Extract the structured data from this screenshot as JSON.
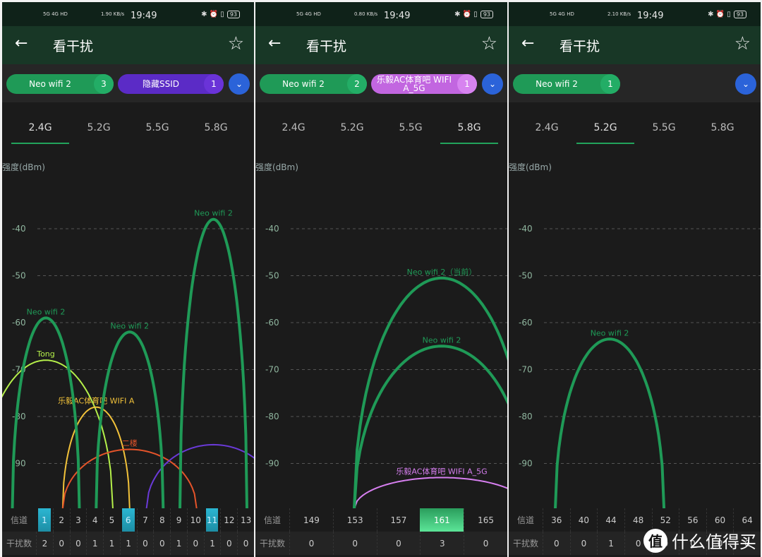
{
  "app_title": "看干扰",
  "y_unit": "强度(dBm)",
  "y_ticks": [
    -40,
    -50,
    -60,
    -70,
    -80,
    -90
  ],
  "row_labels": {
    "channel": "信道",
    "interference": "干扰数"
  },
  "tabs": [
    "2.4G",
    "5.2G",
    "5.5G",
    "5.8G"
  ],
  "watermark": {
    "circle": "值",
    "text": "什么值得买"
  },
  "panels": [
    {
      "status": {
        "time": "19:49",
        "speed": "1.90 KB/s",
        "battery": "93",
        "left": "5G 4G HD"
      },
      "chips": [
        {
          "label": "Neo wifi 2",
          "count": "3",
          "color": "#1f9a57",
          "count_color": "#23ad66"
        },
        {
          "label": "隐藏SSID",
          "count": "1",
          "color": "#5b2bc6",
          "count_color": "#6a33d8"
        }
      ],
      "selected_tab": "2.4G",
      "channels": [
        "1",
        "2",
        "3",
        "4",
        "5",
        "6",
        "7",
        "8",
        "9",
        "10",
        "11",
        "12",
        "13"
      ],
      "interference": [
        "2",
        "0",
        "0",
        "1",
        "1",
        "1",
        "0",
        "0",
        "1",
        "0",
        "1",
        "0",
        "0"
      ],
      "highlighted": [
        "1",
        "6",
        "11"
      ],
      "highlight_style": "cyan",
      "networks": [
        {
          "name": "Tong",
          "channel": 1,
          "dbm": -68,
          "halfwidth": 4,
          "color": "#b5f04a",
          "thick": false
        },
        {
          "name": "乐毅AC体育吧 WIFI A",
          "channel": 4,
          "dbm": -78,
          "halfwidth": 2,
          "color": "#f2c23a",
          "thick": false
        },
        {
          "name": "二楼",
          "channel": 6,
          "dbm": -87,
          "halfwidth": 4,
          "color": "#e5542a",
          "thick": false
        },
        {
          "name": "",
          "channel": 11,
          "dbm": -86,
          "halfwidth": 4,
          "color": "#6a3ad8",
          "thick": false
        },
        {
          "name": "Neo wifi 2",
          "channel": 1,
          "dbm": -59,
          "halfwidth": 2,
          "color": "#1f9a57",
          "thick": true
        },
        {
          "name": "Neo wifi 2",
          "channel": 6,
          "dbm": -62,
          "halfwidth": 2,
          "color": "#1f9a57",
          "thick": true
        },
        {
          "name": "Neo wifi 2",
          "channel": 11,
          "dbm": -38,
          "halfwidth": 2,
          "color": "#1f9a57",
          "thick": true
        }
      ]
    },
    {
      "status": {
        "time": "19:49",
        "speed": "0.80 KB/s",
        "battery": "93",
        "left": "5G 4G HD"
      },
      "chips": [
        {
          "label": "Neo wifi 2",
          "count": "2",
          "color": "#1f9a57",
          "count_color": "#23ad66"
        },
        {
          "label": "乐毅AC体育吧 WIFI A_5G",
          "count": "1",
          "color": "#c266e0",
          "count_color": "#d783f0"
        }
      ],
      "selected_tab": "5.8G",
      "channels": [
        "149",
        "153",
        "157",
        "161",
        "165"
      ],
      "interference": [
        "0",
        "0",
        "0",
        "3",
        "0"
      ],
      "highlighted": [
        "161"
      ],
      "highlight_style": "green",
      "networks": [
        {
          "name": "乐毅AC体育吧 WIFI A_5G",
          "channel": 161,
          "dbm": -93,
          "halfwidth": 8,
          "color": "#d77ff0",
          "thick": false
        },
        {
          "name": "Neo wifi 2（当前）",
          "channel": 161,
          "dbm": -50.5,
          "halfwidth": 8,
          "color": "#1f9a57",
          "thick": true
        },
        {
          "name": "Neo wifi 2",
          "channel": 161,
          "dbm": -65,
          "halfwidth": 8,
          "color": "#1f9a57",
          "thick": true
        }
      ]
    },
    {
      "status": {
        "time": "19:49",
        "speed": "2.10 KB/s",
        "battery": "93",
        "left": "5G 4G HD"
      },
      "chips": [
        {
          "label": "Neo wifi 2",
          "count": "1",
          "color": "#1f9a57",
          "count_color": "#23ad66"
        }
      ],
      "selected_tab": "5.2G",
      "channels": [
        "36",
        "40",
        "44",
        "48",
        "52",
        "56",
        "60",
        "64"
      ],
      "interference": [
        "0",
        "0",
        "1",
        "0",
        "0",
        "0",
        "0",
        "0"
      ],
      "highlighted": [],
      "highlight_style": "none",
      "networks": [
        {
          "name": "Neo wifi 2",
          "channel": 44,
          "dbm": -63.5,
          "halfwidth": 8,
          "color": "#1f9a57",
          "thick": true
        }
      ]
    }
  ]
}
